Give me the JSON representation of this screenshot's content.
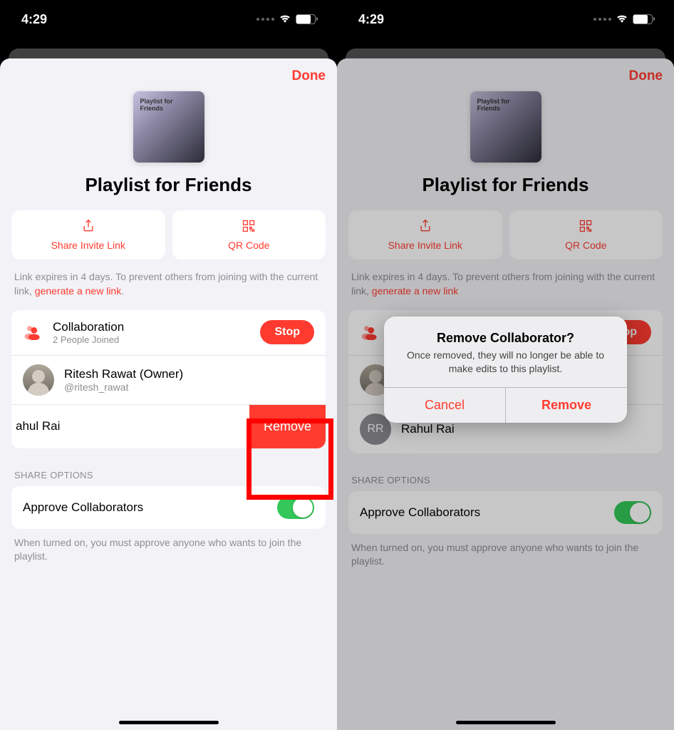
{
  "status": {
    "time": "4:29"
  },
  "done": "Done",
  "album": {
    "label1": "Playlist for",
    "label2": "Friends"
  },
  "title": "Playlist for Friends",
  "buttons": {
    "share": "Share Invite Link",
    "qr": "QR Code"
  },
  "info": {
    "text": "Link expires in 4 days. To prevent others from joining with the current link, ",
    "link": "generate a new link"
  },
  "collab": {
    "title": "Collaboration",
    "sub": "2 People Joined",
    "stop": "Stop"
  },
  "owner": {
    "name": "Ritesh Rawat (Owner)",
    "handle": "@ritesh_rawat"
  },
  "member": {
    "shifted": "ahul Rai",
    "full": "Rahul Rai",
    "initials": "RR"
  },
  "swipeRemove": "Remove",
  "section": "SHARE OPTIONS",
  "approve": "Approve Collaborators",
  "footer": "When turned on, you must approve anyone who wants to join the playlist.",
  "alert": {
    "title": "Remove Collaborator?",
    "msg": "Once removed, they will no longer be able to make edits to this playlist.",
    "cancel": "Cancel",
    "remove": "Remove"
  }
}
